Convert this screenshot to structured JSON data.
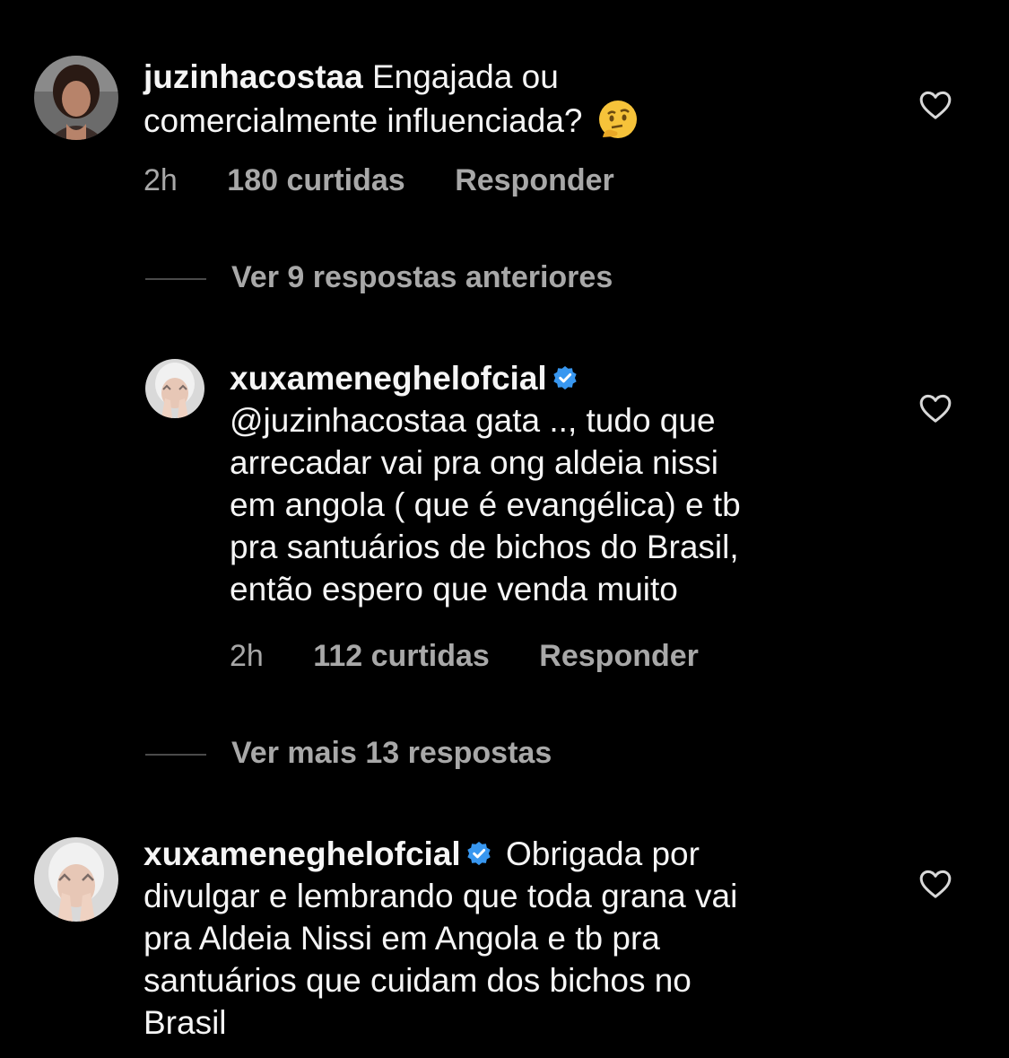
{
  "comments": [
    {
      "username": "juzinhacostaa",
      "text": "Engajada ou comercialmente influenciada?",
      "emoji": "thinking-face-emoji",
      "time": "2h",
      "likes": "180 curtidas",
      "reply": "Responder"
    },
    {
      "username": "xuxameneghelofcial",
      "verified": true,
      "text": "@juzinhacostaa gata .., tudo que arrecadar vai pra ong aldeia nissi em angola ( que é evangélica) e tb pra santuários de bichos do Brasil, então espero que venda muito",
      "time": "2h",
      "likes": "112 curtidas",
      "reply": "Responder"
    },
    {
      "username": "xuxameneghelofcial",
      "verified": true,
      "text": "Obrigada por divulgar e lembrando que toda grana vai pra Aldeia Nissi em Angola e tb pra santuários que cuidam dos bichos no Brasil"
    }
  ],
  "view_previous": "Ver 9 respostas anteriores",
  "view_more": "Ver mais 13 respostas",
  "colors": {
    "background": "#000000",
    "text": "#f5f5f5",
    "muted": "#a8a8a8",
    "verified": "#3897f0"
  }
}
